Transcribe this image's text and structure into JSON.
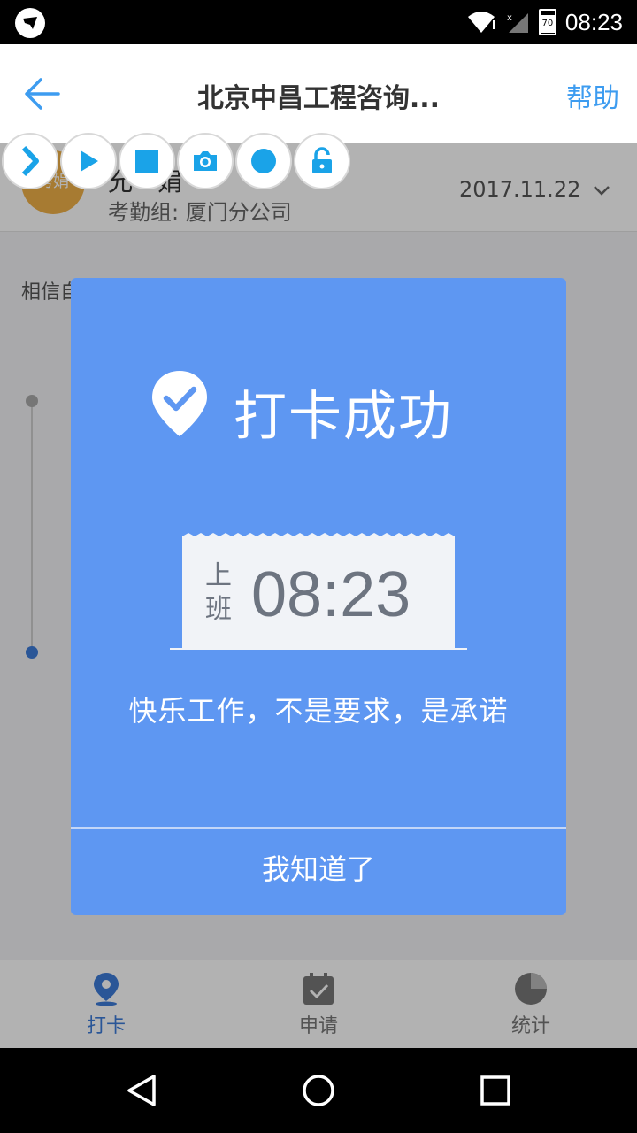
{
  "status_bar": {
    "time": "08:23",
    "battery": "70"
  },
  "header": {
    "title": "北京中昌工程咨询...",
    "help": "帮助"
  },
  "profile": {
    "avatar_text": "秀娟",
    "name": "允　娟",
    "group": "考勤组: 厦门分公司",
    "date": "2017.11.22"
  },
  "background": {
    "quote": "相信自己，努力奋斗"
  },
  "dialog": {
    "title": "打卡成功",
    "shift": "上班",
    "time": "08:23",
    "motto": "快乐工作，不是要求，是承诺",
    "button": "我知道了"
  },
  "bottom_nav": [
    {
      "label": "打卡",
      "icon": "location-pin-icon"
    },
    {
      "label": "申请",
      "icon": "calendar-check-icon"
    },
    {
      "label": "统计",
      "icon": "pie-chart-icon"
    }
  ],
  "toolbar_icons": [
    "chevron-right-icon",
    "play-icon",
    "stop-icon",
    "camera-icon",
    "record-icon",
    "unlock-icon"
  ],
  "colors": {
    "primary": "#3d7bd9",
    "dialog": "#5e97f2",
    "help": "#3d9cf0",
    "toolbar": "#1aa3e8"
  }
}
